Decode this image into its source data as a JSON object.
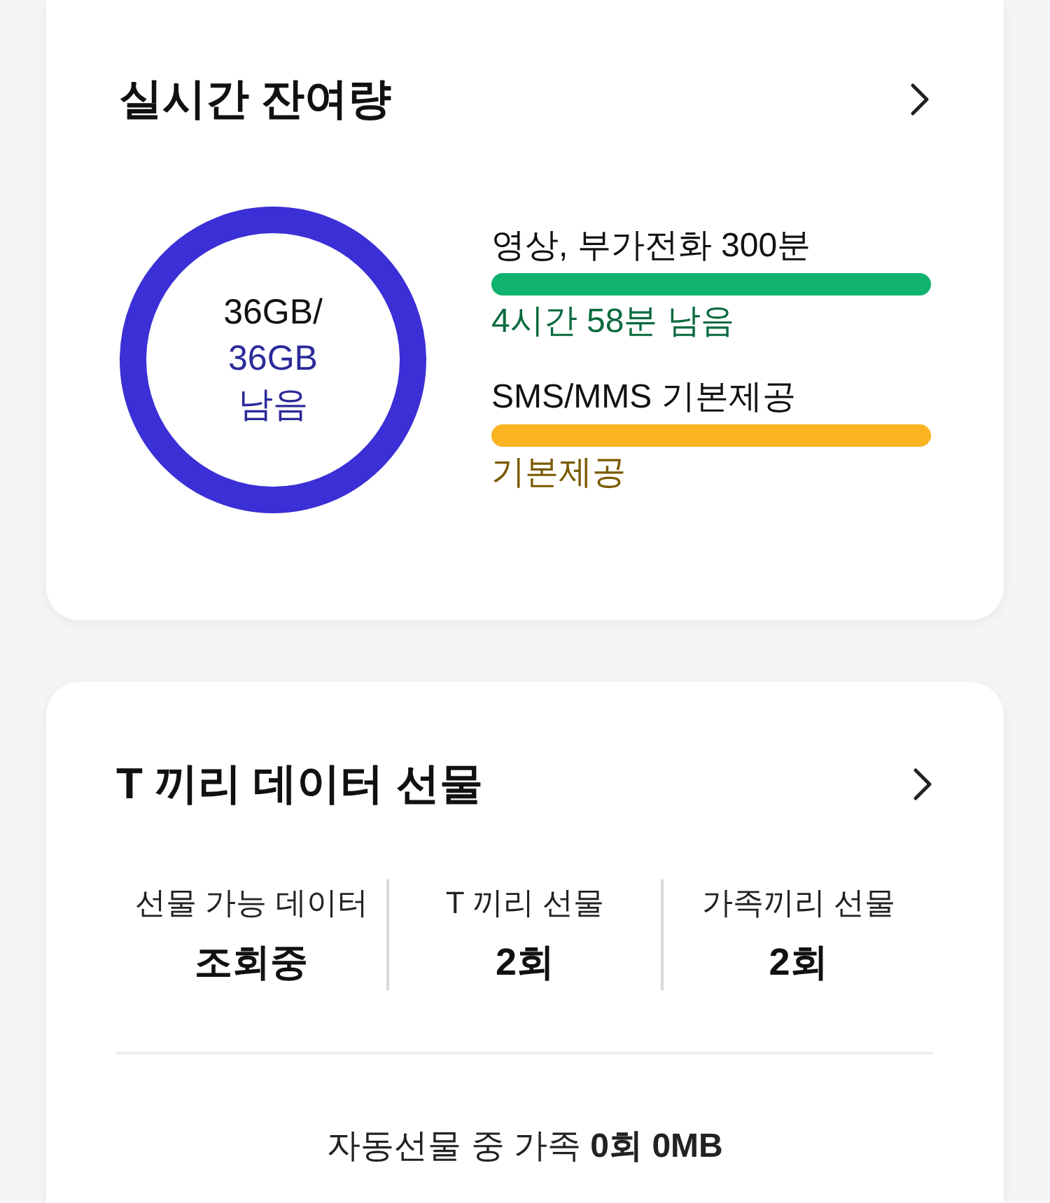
{
  "remaining": {
    "title": "실시간 잔여량",
    "data": {
      "level": 1,
      "used_text": "36GB/",
      "remain_amount": "36GB",
      "remain_label": "남음"
    },
    "items": [
      {
        "label": "영상, 부가전화 300분",
        "level": 1,
        "color": "#10b46f",
        "status": "4시간 58분 남음"
      },
      {
        "label": "SMS/MMS 기본제공",
        "level": 1,
        "color": "#fbb322",
        "status": "기본제공"
      }
    ]
  },
  "gift": {
    "title": "T 끼리 데이터 선물",
    "stats": [
      {
        "label": "선물 가능 데이터",
        "value": "조회중"
      },
      {
        "label": "T 끼리 선물",
        "value": "2회"
      },
      {
        "label": "가족끼리 선물",
        "value": "2회"
      }
    ],
    "auto": "자동선물 중 가족 **0회** **0MB**"
  }
}
